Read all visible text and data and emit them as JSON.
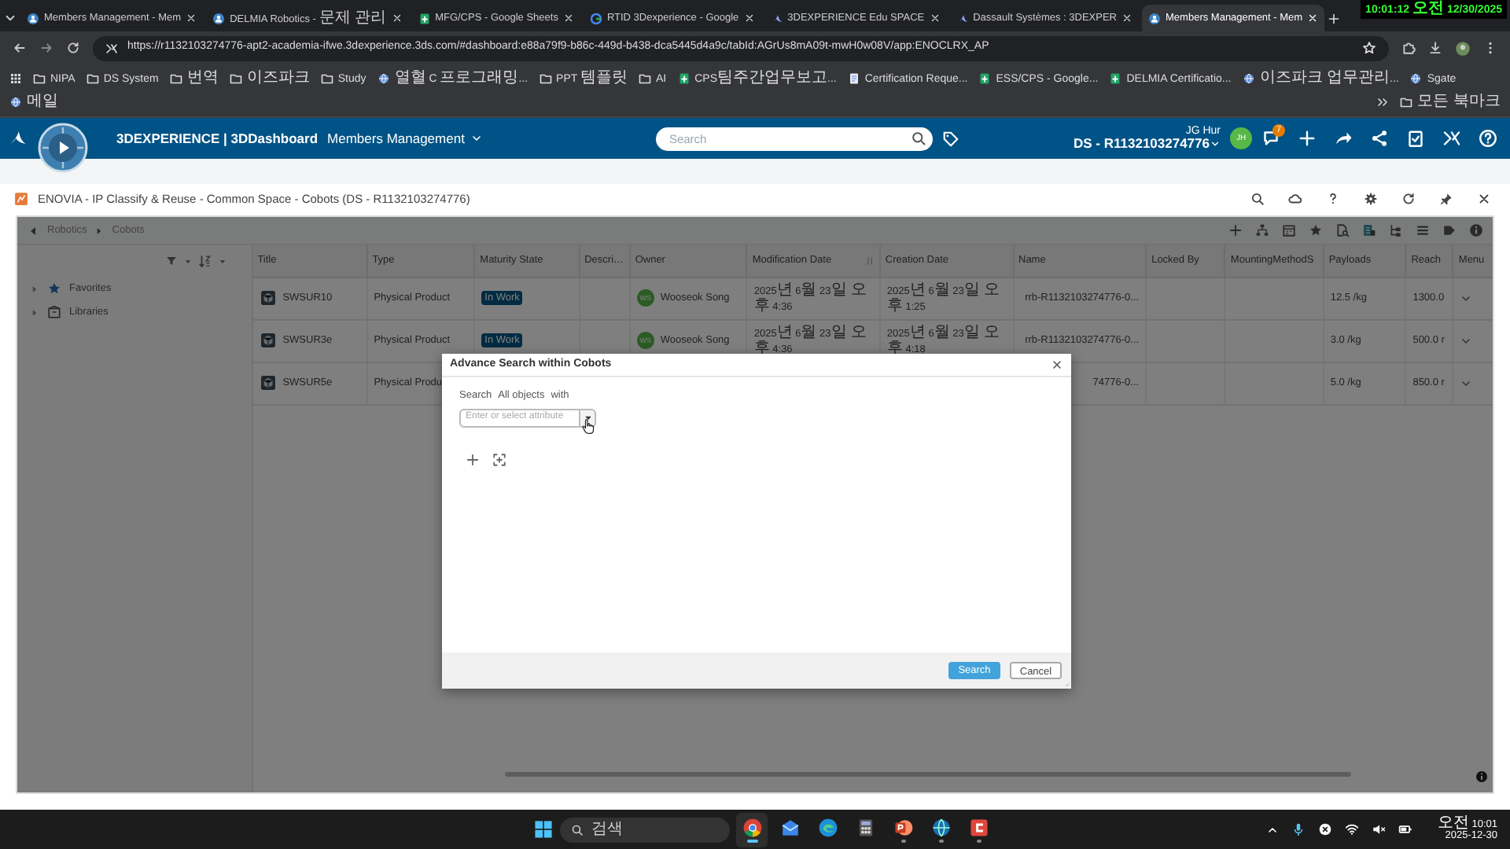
{
  "browser": {
    "tabs": [
      {
        "title": "Members Management - Mem",
        "kind": "dashboard",
        "selected": false
      },
      {
        "title": "DELMIA Robotics - 문제 관리",
        "kind": "dashboard",
        "selected": false
      },
      {
        "title": "MFG/CPS - Google Sheets",
        "kind": "sheet",
        "selected": false
      },
      {
        "title": "RTID 3Dexperience - Google",
        "kind": "google",
        "selected": false
      },
      {
        "title": "3DEXPERIENCE Edu SPACE",
        "kind": "ds",
        "selected": false
      },
      {
        "title": "Dassault Systèmes : 3DEXPER",
        "kind": "ds",
        "selected": false
      },
      {
        "title": "Members Management - Mem",
        "kind": "dashboard",
        "selected": true
      }
    ],
    "clock": "10:01:12 오전 12/30/2025",
    "url": "https://r1132103274776-apt2-academia-ifwe.3dexperience.3ds.com/#dashboard:e88a79f9-b86c-449d-b438-dca5445d4a9c/tabId:AGrUs8mA09t-mwH0w08V/app:ENOCLRX_AP",
    "bookmarks": [
      {
        "label": "NIPA",
        "kind": "folder"
      },
      {
        "label": "DS System",
        "kind": "folder"
      },
      {
        "label": "번역",
        "kind": "folder"
      },
      {
        "label": "이즈파크",
        "kind": "folder"
      },
      {
        "label": "Study",
        "kind": "folder"
      },
      {
        "label": "열혈 C 프로그래밍...",
        "kind": "site"
      },
      {
        "label": "PPT 템플릿",
        "kind": "folder"
      },
      {
        "label": "AI",
        "kind": "folder"
      },
      {
        "label": "CPS팀주간업무보고...",
        "kind": "sheet"
      },
      {
        "label": "Certification Reque...",
        "kind": "doc"
      },
      {
        "label": "ESS/CPS - Google...",
        "kind": "sheet"
      },
      {
        "label": "DELMIA Certificatio...",
        "kind": "sheet"
      },
      {
        "label": "이즈파크 업무관리...",
        "kind": "site"
      },
      {
        "label": "Sgate",
        "kind": "site"
      },
      {
        "label": "메일",
        "kind": "site"
      }
    ],
    "all_bookmarks": "모든 북마크"
  },
  "top_bar": {
    "brand": "3DEXPERIENCE | 3DDashboard",
    "dashboard": "Members Management",
    "search_placeholder": "Search",
    "user_name": "JG Hur",
    "tenant": "DS - R1132103274776",
    "avatar": "JH",
    "notifications": "7"
  },
  "widget": {
    "title": "ENOVIA - IP Classify & Reuse - Common Space - Cobots (DS - R1132103274776)",
    "breadcrumb": [
      "Robotics",
      "Cobots"
    ],
    "tree": [
      {
        "label": "Favorites",
        "kind": "favorites",
        "expanded": false
      },
      {
        "label": "Libraries",
        "kind": "libraries",
        "expanded": false
      }
    ],
    "table": {
      "columns": [
        "Title",
        "Type",
        "Maturity State",
        "Descri…",
        "Owner",
        "Modification Date",
        "Creation Date",
        "Name",
        "Locked By",
        "MountingMethodS",
        "Payloads",
        "Reach",
        "Menu"
      ],
      "rows": [
        {
          "title": "SWSUR10",
          "type": "Physical Product",
          "maturity": "In Work",
          "owner": "Wooseok Song",
          "owner_initials": "WS",
          "modified": "2025년 6월 23일 오후 4:36",
          "created": "2025년 6월 23일 오후 1:25",
          "name": "rrb-R1132103274776-0...",
          "payloads": "12.5 /kg",
          "reach": "1300.0"
        },
        {
          "title": "SWSUR3e",
          "type": "Physical Product",
          "maturity": "In Work",
          "owner": "Wooseok Song",
          "owner_initials": "WS",
          "modified": "2025년 6월 23일 오후 4:36",
          "created": "2025년 6월 23일 오후 4:18",
          "name": "rrb-R1132103274776-0...",
          "payloads": "3.0 /kg",
          "reach": "500.0 r"
        },
        {
          "title": "SWSUR5e",
          "type": "Physical Produ",
          "name": "74776-0...",
          "payloads": "5.0 /kg",
          "reach": "850.0 r"
        }
      ]
    }
  },
  "dialog": {
    "title": "Advance Search within Cobots",
    "prefix": "Search",
    "scope": "All objects",
    "suffix": "with",
    "attribute_placeholder": "Enter or select attribute",
    "buttons": [
      {
        "label": "Search",
        "kind": "primary"
      },
      {
        "label": "Cancel",
        "kind": "secondary"
      }
    ]
  },
  "taskbar": {
    "search_placeholder": "검색",
    "apps": [
      {
        "kind": "chrome",
        "running": true,
        "selected": true
      },
      {
        "kind": "mail",
        "running": false,
        "selected": false
      },
      {
        "kind": "edge",
        "running": false,
        "selected": false
      },
      {
        "kind": "calculator",
        "running": false,
        "selected": false
      },
      {
        "kind": "powerpoint",
        "running": true,
        "selected": false
      },
      {
        "kind": "globe",
        "running": true,
        "selected": false
      },
      {
        "kind": "app",
        "running": true,
        "selected": false
      }
    ],
    "time": "오전 10:01",
    "date": "2025-12-30"
  }
}
